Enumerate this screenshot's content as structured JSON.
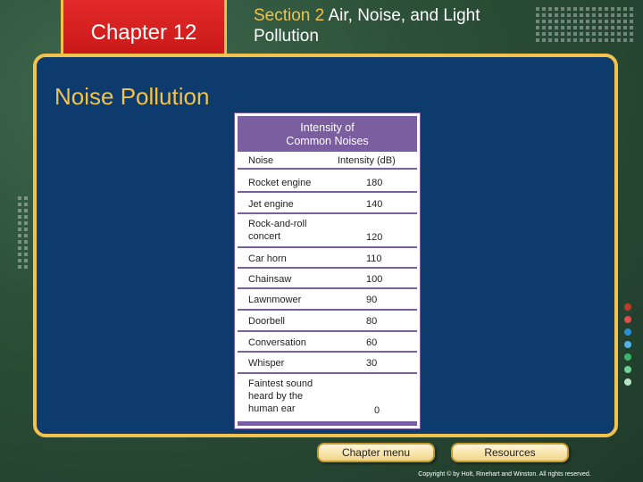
{
  "header": {
    "chapter_label": "Chapter 12",
    "section_number": "Section 2",
    "section_title": "Air, Noise, and Light Pollution"
  },
  "slide": {
    "heading": "Noise Pollution"
  },
  "table": {
    "title_line1": "Intensity of",
    "title_line2": "Common Noises",
    "col_noise": "Noise",
    "col_intensity": "Intensity (dB)",
    "rows": [
      {
        "noise": "Rocket engine",
        "db": "180"
      },
      {
        "noise": "Jet engine",
        "db": "140"
      },
      {
        "noise": "Rock-and-roll concert",
        "db": "120"
      },
      {
        "noise": "Car horn",
        "db": "110"
      },
      {
        "noise": "Chainsaw",
        "db": "100"
      },
      {
        "noise": "Lawnmower",
        "db": "90"
      },
      {
        "noise": "Doorbell",
        "db": "80"
      },
      {
        "noise": "Conversation",
        "db": "60"
      },
      {
        "noise": "Whisper",
        "db": "30"
      },
      {
        "noise": "Faintest sound heard by the human ear",
        "db": "0"
      }
    ]
  },
  "nav": {
    "chapter_menu": "Chapter menu",
    "resources": "Resources"
  },
  "footer": {
    "copyright": "Copyright © by Holt, Rinehart and Winston. All rights reserved."
  },
  "colors": {
    "panel": "#0d3b6e",
    "accent_gold": "#f2c24a",
    "tab_red": "#d41c1c",
    "table_purple": "#7a5ea0"
  }
}
